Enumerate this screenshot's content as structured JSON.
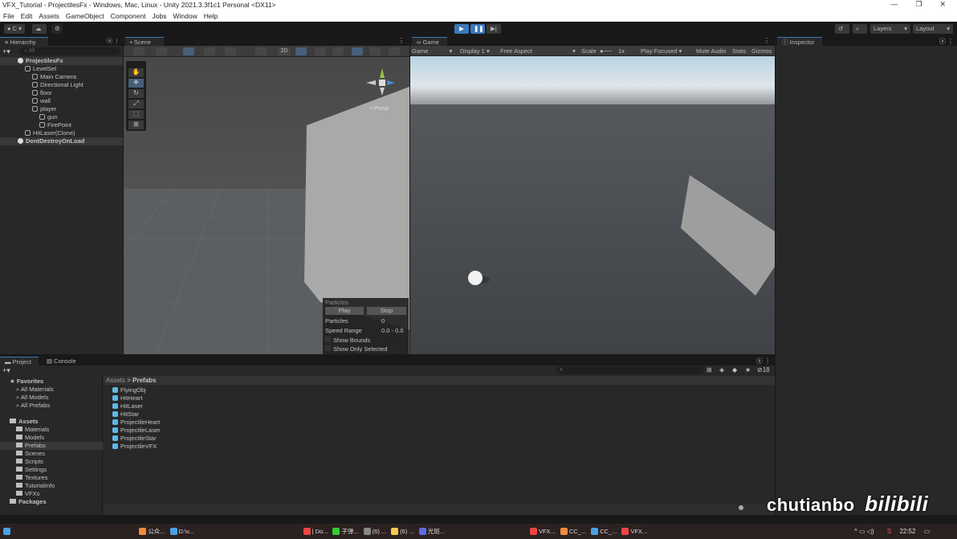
{
  "window": {
    "title": "VFX_Tutorial - ProjectilesFx - Windows, Mac, Linux - Unity 2021.3.3f1c1 Personal <DX11>",
    "minimize": "—",
    "restore": "❐",
    "close": "✕"
  },
  "menu": [
    "File",
    "Edit",
    "Assets",
    "GameObject",
    "Component",
    "Jobs",
    "Window",
    "Help"
  ],
  "toolbar": {
    "account": "C",
    "layers": "Layers",
    "layout": "Layout"
  },
  "hierarchy": {
    "tab": "Hierarchy",
    "search_placeholder": "All",
    "items": [
      {
        "label": "ProjectilesFx",
        "depth": 0,
        "type": "scene"
      },
      {
        "label": "LevelSet",
        "depth": 1,
        "type": "object"
      },
      {
        "label": "Main Camera",
        "depth": 2,
        "type": "object"
      },
      {
        "label": "Directional Light",
        "depth": 2,
        "type": "object"
      },
      {
        "label": "floor",
        "depth": 2,
        "type": "object"
      },
      {
        "label": "wall",
        "depth": 2,
        "type": "object"
      },
      {
        "label": "player",
        "depth": 2,
        "type": "object"
      },
      {
        "label": "gun",
        "depth": 3,
        "type": "object"
      },
      {
        "label": "FirePoint",
        "depth": 3,
        "type": "object"
      },
      {
        "label": "HitLaser(Clone)",
        "depth": 1,
        "type": "object"
      },
      {
        "label": "DontDestroyOnLoad",
        "depth": 0,
        "type": "scene"
      }
    ]
  },
  "scene": {
    "tab": "Scene",
    "mode_2d": "2D",
    "persp": "< Persp",
    "particles": {
      "title": "Particles",
      "play": "Play",
      "stop": "Stop",
      "count_label": "Particles",
      "count": "0",
      "speed_label": "Speed Range",
      "speed": "0.0 - 0.0",
      "show_bounds": "Show Bounds",
      "show_only_selected": "Show Only Selected"
    }
  },
  "game": {
    "tab": "Game",
    "view": "Game",
    "display": "Display 1",
    "aspect": "Free Aspect",
    "scale_label": "Scale",
    "scale": "1x",
    "play_focused": "Play Focused",
    "mute": "Mute Audio",
    "stats": "Stats",
    "gizmos": "Gizmos"
  },
  "inspector": {
    "tab": "Inspector"
  },
  "project": {
    "tab_project": "Project",
    "tab_console": "Console",
    "hidden_count": "18",
    "favorites": {
      "label": "Favorites",
      "items": [
        "All Materials",
        "All Models",
        "All Prefabs"
      ]
    },
    "assets": {
      "label": "Assets",
      "items": [
        "Materials",
        "Models",
        "Prefabs",
        "Scenes",
        "Scripts",
        "Settings",
        "Textures",
        "TutorialInfo",
        "VFXs"
      ]
    },
    "packages": "Packages",
    "breadcrumb": [
      "Assets",
      "Prefabs"
    ],
    "files": [
      "FlyingObj",
      "HitHeart",
      "HitLaser",
      "HitStar",
      "ProjectileHeart",
      "ProjectileLaser",
      "ProjectileStar",
      "ProjectileVFX"
    ]
  },
  "watermark": {
    "author": "chutianbo",
    "site": "bilibili"
  },
  "taskbar": {
    "items": [
      "公众...",
      "D:\\v...",
      "| Do...",
      "子弹...",
      "(6) ...",
      "(6) ...",
      "光斑...",
      "VFX...",
      "CC_...",
      "CC_...",
      "VFX..."
    ],
    "time": "22:52"
  },
  "colors": {
    "accent": "#3a79bb",
    "prefab": "#5fb8e6"
  }
}
